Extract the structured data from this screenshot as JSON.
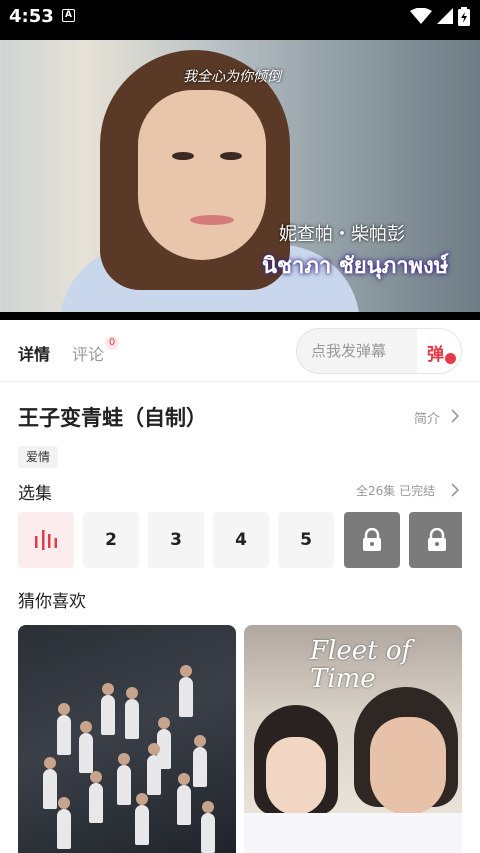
{
  "status_bar": {
    "time": "4:53",
    "notification_letter": "A",
    "icons": [
      "notification-icon",
      "wifi-icon",
      "signal-icon",
      "battery-icon"
    ]
  },
  "video": {
    "caption_top": "我全心为你倾倒",
    "caption_cn": "妮查帕・柴帕彭",
    "caption_thai": "นิชาภา ชัยนุภาพงษ์"
  },
  "tabs": {
    "detail_label": "详情",
    "comment_label": "评论",
    "comment_count": "0"
  },
  "danmu": {
    "placeholder": "点我发弹幕",
    "toggle_label": "弹"
  },
  "show": {
    "title": "王子变青蛙（自制）",
    "intro_label": "简介",
    "genre_tag": "爱情"
  },
  "episodes": {
    "heading": "选集",
    "summary": "全26集 已完结",
    "items": [
      {
        "label": "",
        "state": "playing"
      },
      {
        "label": "2",
        "state": "normal"
      },
      {
        "label": "3",
        "state": "normal"
      },
      {
        "label": "4",
        "state": "normal"
      },
      {
        "label": "5",
        "state": "normal"
      },
      {
        "label": "",
        "state": "locked"
      },
      {
        "label": "",
        "state": "locked"
      }
    ]
  },
  "recommendations": {
    "heading": "猜你喜欢",
    "cards": [
      {
        "overlay_title": ""
      },
      {
        "overlay_title": "Fleet of Time"
      }
    ]
  },
  "colors": {
    "accent": "#e33b4a",
    "playing_bg": "#fdecee",
    "locked_bg": "#7b7b7b"
  }
}
